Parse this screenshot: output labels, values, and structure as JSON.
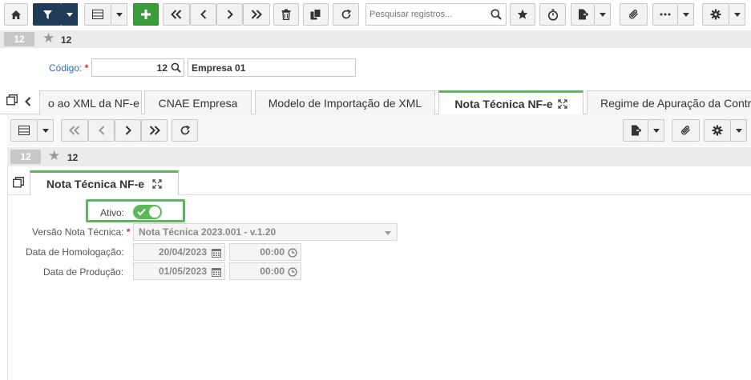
{
  "toolbar": {
    "search_placeholder": "Pesquisar registros...",
    "buttons": [
      "home-icon",
      "filter-icon",
      "grid-icon",
      "add-icon",
      "first-icon",
      "prev-icon",
      "next-icon",
      "last-icon",
      "delete-icon",
      "copy-icon",
      "refresh-icon",
      "search-icon",
      "star-icon",
      "timer-icon",
      "report-icon",
      "attach-icon",
      "more-icon",
      "gear-icon"
    ]
  },
  "record_bar": {
    "badge": "12",
    "count": "12"
  },
  "company": {
    "codigo_label": "Código:",
    "codigo_value": "12",
    "nome_value": "Empresa 01"
  },
  "tabs": [
    {
      "label": "o ao XML da NF-e"
    },
    {
      "label": "CNAE Empresa"
    },
    {
      "label": "Modelo de Importação de XML"
    },
    {
      "label": "Nota Técnica NF-e",
      "active": true
    },
    {
      "label": "Regime de Apuração da Contr"
    }
  ],
  "sub_record_bar": {
    "badge": "12",
    "count": "12"
  },
  "detail_tab": {
    "label": "Nota Técnica NF-e"
  },
  "form": {
    "ativo_label": "Ativo:",
    "ativo_value": true,
    "versao_label": "Versão Nota Técnica:",
    "versao_value": "Nota Técnica 2023.001 - v.1.20",
    "homologacao_label": "Data de Homologação:",
    "homologacao_date": "20/04/2023",
    "homologacao_time": "00:00",
    "producao_label": "Data de Produção:",
    "producao_date": "01/05/2023",
    "producao_time": "00:00"
  },
  "colors": {
    "accent_green": "#5cb85c",
    "dark_blue": "#1f3b57",
    "link_blue": "#2a6ebb",
    "required_red": "#c9302c"
  }
}
